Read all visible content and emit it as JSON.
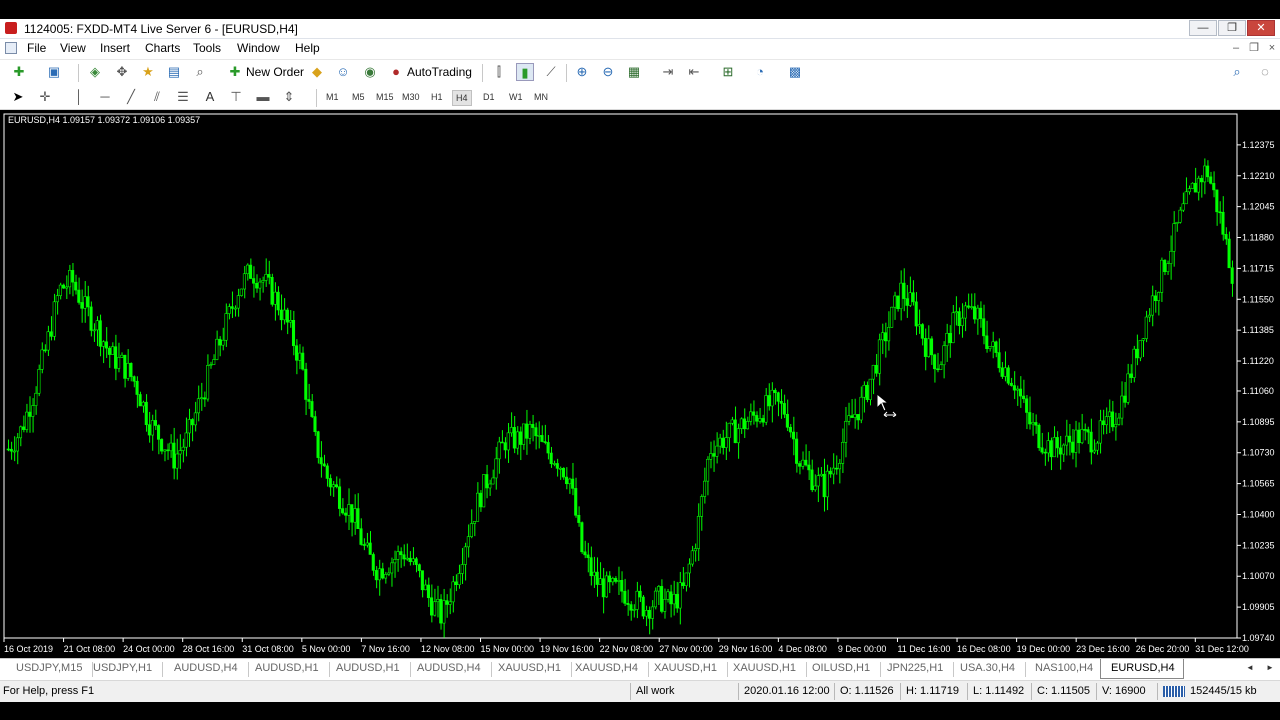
{
  "window": {
    "title": "1124005: FXDD-MT4 Live Server 6 - [EURUSD,H4]",
    "min_glyph": "—",
    "max_glyph": "❐",
    "close_glyph": "✕"
  },
  "menu": {
    "items": [
      "File",
      "View",
      "Insert",
      "Charts",
      "Tools",
      "Window",
      "Help"
    ],
    "mdi_min": "–",
    "mdi_restore": "❐",
    "mdi_close": "×"
  },
  "toolbar": {
    "new_order_label": "New Order",
    "autotrading_label": "AutoTrading",
    "timeframes": [
      "M1",
      "M5",
      "M15",
      "M30",
      "H1",
      "H4",
      "D1",
      "W1",
      "MN"
    ],
    "active_timeframe": "H4",
    "text_tool": "A"
  },
  "chart": {
    "symbol_info": "EURUSD,H4  1.09157 1.09372 1.09106 1.09357",
    "background_color": "#000000",
    "bar_color": "#00ff00",
    "price_labels": [
      "1.12375",
      "1.12210",
      "1.12045",
      "1.11880",
      "1.11715",
      "1.11550",
      "1.11385",
      "1.11220",
      "1.11060",
      "1.10895",
      "1.10730",
      "1.10565",
      "1.10400",
      "1.10235",
      "1.10070",
      "1.09905",
      "1.09740"
    ],
    "time_labels": [
      "16 Oct 2019",
      "21 Oct 08:00",
      "24 Oct 00:00",
      "28 Oct 16:00",
      "31 Oct 08:00",
      "5 Nov 00:00",
      "7 Nov 16:00",
      "12 Nov 08:00",
      "15 Nov 00:00",
      "19 Nov 16:00",
      "22 Nov 08:00",
      "27 Nov 00:00",
      "29 Nov 16:00",
      "4 Dec 08:00",
      "9 Dec 00:00",
      "11 Dec 16:00",
      "16 Dec 08:00",
      "19 Dec 00:00",
      "23 Dec 16:00",
      "26 Dec 20:00",
      "31 Dec 12:00"
    ]
  },
  "chart_data": {
    "type": "ohlc",
    "symbol": "EURUSD",
    "timeframe": "H4",
    "ylim": [
      1.0974,
      1.1254
    ],
    "close_path": [
      1.1075,
      1.1085,
      1.1105,
      1.113,
      1.116,
      1.1165,
      1.115,
      1.114,
      1.1125,
      1.112,
      1.111,
      1.109,
      1.108,
      1.107,
      1.108,
      1.11,
      1.112,
      1.114,
      1.116,
      1.117,
      1.1165,
      1.1155,
      1.114,
      1.112,
      1.108,
      1.106,
      1.105,
      1.104,
      1.102,
      1.101,
      1.1015,
      1.102,
      1.101,
      1.0995,
      1.0985,
      1.1005,
      1.103,
      1.105,
      1.1065,
      1.108,
      1.108,
      1.1085,
      1.1075,
      1.107,
      1.106,
      1.102,
      1.1005,
      1.1,
      1.1,
      1.0995,
      1.099,
      1.0995,
      1.0992,
      1.1,
      1.103,
      1.1075,
      1.108,
      1.1085,
      1.109,
      1.1095,
      1.11,
      1.1095,
      1.107,
      1.106,
      1.1055,
      1.107,
      1.109,
      1.11,
      1.112,
      1.114,
      1.116,
      1.115,
      1.113,
      1.112,
      1.114,
      1.115,
      1.1145,
      1.113,
      1.112,
      1.111,
      1.109,
      1.108,
      1.1075,
      1.1078,
      1.1082,
      1.108,
      1.1085,
      1.1095,
      1.1115,
      1.114,
      1.116,
      1.118,
      1.12,
      1.1215,
      1.1225,
      1.12,
      1.117
    ]
  },
  "tabs": {
    "items": [
      "USDJPY,M15",
      "USDJPY,H1",
      "AUDUSD,H4",
      "AUDUSD,H1",
      "AUDUSD,H1",
      "AUDUSD,H4",
      "XAUUSD,H1",
      "XAUUSD,H4",
      "XAUUSD,H1",
      "XAUUSD,H1",
      "OILUSD,H1",
      "JPN225,H1",
      "USA.30,H4",
      "NAS100,H4",
      "EURUSD,H4"
    ],
    "active": "EURUSD,H4",
    "scroll_left": "◄",
    "scroll_right": "►"
  },
  "status": {
    "help": "For Help, press F1",
    "profile": "All work",
    "datetime": "2020.01.16 12:00",
    "open": "O: 1.11526",
    "high": "H: 1.11719",
    "low": "L: 1.11492",
    "close": "C: 1.11505",
    "volume": "V: 16900",
    "traffic": "152445/15 kb"
  }
}
